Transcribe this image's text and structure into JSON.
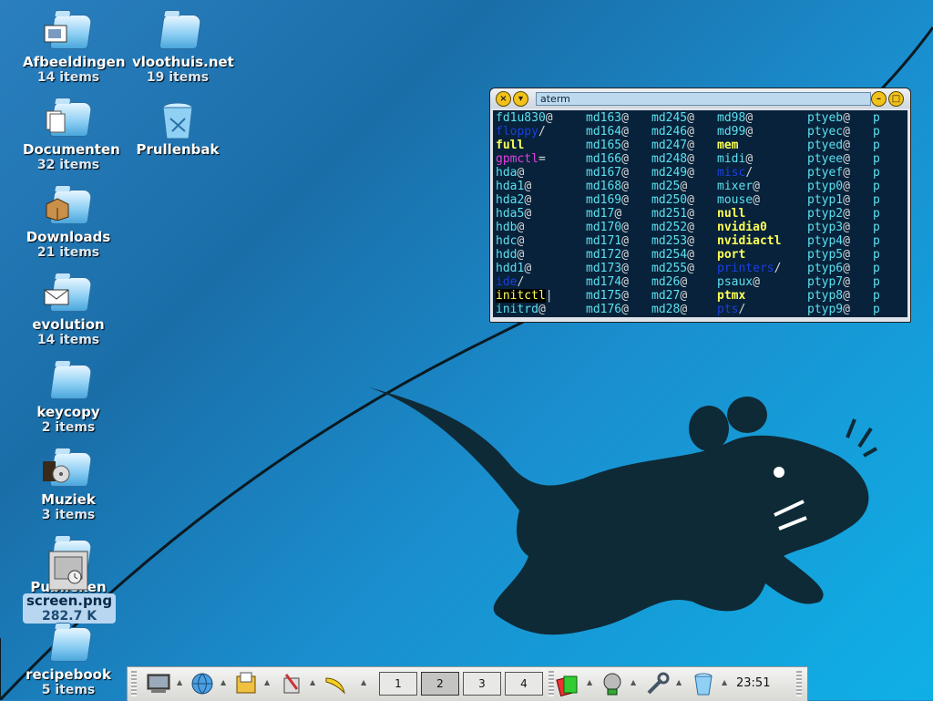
{
  "desktop": {
    "icons": [
      {
        "name": "Afbeeldingen",
        "count": "14 items",
        "icon": "folder-pictures-icon"
      },
      {
        "name": "vloothuis.net",
        "count": "19 items",
        "icon": "folder-icon"
      },
      {
        "name": "Documenten",
        "count": "32 items",
        "icon": "folder-documents-icon"
      },
      {
        "name": "Prullenbak",
        "icon": "trash-icon"
      },
      {
        "name": "Downloads",
        "count": "21 items",
        "icon": "folder-downloads-icon"
      },
      {
        "name": "evolution",
        "count": "14 items",
        "icon": "folder-mail-icon"
      },
      {
        "name": "keycopy",
        "count": "2 items",
        "icon": "folder-icon"
      },
      {
        "name": "Muziek",
        "count": "3 items",
        "icon": "folder-music-icon"
      },
      {
        "name": "Publieken",
        "icon": "folder-public-icon"
      },
      {
        "name": "screen.png",
        "count": "282.7 K",
        "icon": "image-file-icon",
        "selected": true
      },
      {
        "name": "recipebook",
        "count": "5 items",
        "icon": "folder-icon"
      }
    ]
  },
  "terminal": {
    "title": "aterm",
    "buttons": [
      "close-icon",
      "menu-icon",
      "minimize-icon",
      "maximize-icon"
    ],
    "rows": [
      [
        [
          "fd1u830",
          "c",
          "@"
        ],
        [
          "md163",
          "c",
          "@"
        ],
        [
          "md245",
          "c",
          "@"
        ],
        [
          "md98",
          "c",
          "@"
        ],
        [
          "ptyeb",
          "c",
          "@"
        ],
        [
          "p",
          "c",
          ""
        ]
      ],
      [
        [
          "floppy",
          "b",
          "/"
        ],
        [
          "md164",
          "c",
          "@"
        ],
        [
          "md246",
          "c",
          "@"
        ],
        [
          "md99",
          "c",
          "@"
        ],
        [
          "ptyec",
          "c",
          "@"
        ],
        [
          "p",
          "c",
          ""
        ]
      ],
      [
        [
          "full",
          "y",
          ""
        ],
        [
          "md165",
          "c",
          "@"
        ],
        [
          "md247",
          "c",
          "@"
        ],
        [
          "mem",
          "y",
          ""
        ],
        [
          "ptyed",
          "c",
          "@"
        ],
        [
          "p",
          "c",
          ""
        ]
      ],
      [
        [
          "gpmctl",
          "m",
          "="
        ],
        [
          "md166",
          "c",
          "@"
        ],
        [
          "md248",
          "c",
          "@"
        ],
        [
          "midi",
          "c",
          "@"
        ],
        [
          "ptyee",
          "c",
          "@"
        ],
        [
          "p",
          "c",
          ""
        ]
      ],
      [
        [
          "hda",
          "c",
          "@"
        ],
        [
          "md167",
          "c",
          "@"
        ],
        [
          "md249",
          "c",
          "@"
        ],
        [
          "misc",
          "b",
          "/"
        ],
        [
          "ptyef",
          "c",
          "@"
        ],
        [
          "p",
          "c",
          ""
        ]
      ],
      [
        [
          "hda1",
          "c",
          "@"
        ],
        [
          "md168",
          "c",
          "@"
        ],
        [
          "md25",
          "c",
          "@"
        ],
        [
          "mixer",
          "c",
          "@"
        ],
        [
          "ptyp0",
          "c",
          "@"
        ],
        [
          "p",
          "c",
          ""
        ]
      ],
      [
        [
          "hda2",
          "c",
          "@"
        ],
        [
          "md169",
          "c",
          "@"
        ],
        [
          "md250",
          "c",
          "@"
        ],
        [
          "mouse",
          "c",
          "@"
        ],
        [
          "ptyp1",
          "c",
          "@"
        ],
        [
          "p",
          "c",
          ""
        ]
      ],
      [
        [
          "hda5",
          "c",
          "@"
        ],
        [
          "md17",
          "c",
          "@"
        ],
        [
          "md251",
          "c",
          "@"
        ],
        [
          "null",
          "y",
          ""
        ],
        [
          "ptyp2",
          "c",
          "@"
        ],
        [
          "p",
          "c",
          ""
        ]
      ],
      [
        [
          "hdb",
          "c",
          "@"
        ],
        [
          "md170",
          "c",
          "@"
        ],
        [
          "md252",
          "c",
          "@"
        ],
        [
          "nvidia0",
          "y",
          ""
        ],
        [
          "ptyp3",
          "c",
          "@"
        ],
        [
          "p",
          "c",
          ""
        ]
      ],
      [
        [
          "hdc",
          "c",
          "@"
        ],
        [
          "md171",
          "c",
          "@"
        ],
        [
          "md253",
          "c",
          "@"
        ],
        [
          "nvidiactl",
          "y",
          ""
        ],
        [
          "ptyp4",
          "c",
          "@"
        ],
        [
          "p",
          "c",
          ""
        ]
      ],
      [
        [
          "hdd",
          "c",
          "@"
        ],
        [
          "md172",
          "c",
          "@"
        ],
        [
          "md254",
          "c",
          "@"
        ],
        [
          "port",
          "y",
          ""
        ],
        [
          "ptyp5",
          "c",
          "@"
        ],
        [
          "p",
          "c",
          ""
        ]
      ],
      [
        [
          "hdd1",
          "c",
          "@"
        ],
        [
          "md173",
          "c",
          "@"
        ],
        [
          "md255",
          "c",
          "@"
        ],
        [
          "printers",
          "b",
          "/"
        ],
        [
          "ptyp6",
          "c",
          "@"
        ],
        [
          "p",
          "c",
          ""
        ]
      ],
      [
        [
          "ide",
          "b",
          "/"
        ],
        [
          "md174",
          "c",
          "@"
        ],
        [
          "md26",
          "c",
          "@"
        ],
        [
          "psaux",
          "c",
          "@"
        ],
        [
          "ptyp7",
          "c",
          "@"
        ],
        [
          "p",
          "c",
          ""
        ]
      ],
      [
        [
          "initctl",
          "s",
          "|"
        ],
        [
          "md175",
          "c",
          "@"
        ],
        [
          "md27",
          "c",
          "@"
        ],
        [
          "ptmx",
          "y",
          ""
        ],
        [
          "ptyp8",
          "c",
          "@"
        ],
        [
          "p",
          "c",
          ""
        ]
      ],
      [
        [
          "initrd",
          "c",
          "@"
        ],
        [
          "md176",
          "c",
          "@"
        ],
        [
          "md28",
          "c",
          "@"
        ],
        [
          "pts",
          "b",
          "/"
        ],
        [
          "ptyp9",
          "c",
          "@"
        ],
        [
          "p",
          "c",
          ""
        ]
      ]
    ]
  },
  "taskbar": {
    "launchers": [
      "monitor-icon",
      "network-globe-icon",
      "file-manager-icon",
      "toolbox-icon",
      "banana-icon"
    ],
    "workspaces": [
      "1",
      "2",
      "3",
      "4"
    ],
    "active_workspace": "2",
    "tray": [
      "card-game-icon",
      "network-monitor-icon",
      "settings-tools-icon",
      "trash-icon"
    ],
    "clock": "23:51"
  }
}
